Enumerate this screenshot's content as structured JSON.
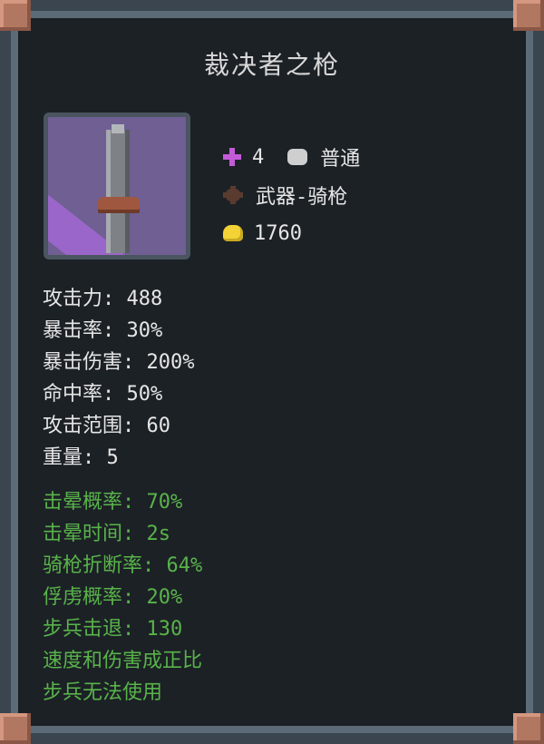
{
  "item": {
    "name": "裁决者之枪",
    "level": "4",
    "rarity": "普通",
    "type": "武器-骑枪",
    "price": "1760"
  },
  "stats": [
    {
      "label": "攻击力",
      "value": "488"
    },
    {
      "label": "暴击率",
      "value": "30%"
    },
    {
      "label": "暴击伤害",
      "value": "200%"
    },
    {
      "label": "命中率",
      "value": "50%"
    },
    {
      "label": "攻击范围",
      "value": "60"
    },
    {
      "label": "重量",
      "value": "5"
    }
  ],
  "bonuses": [
    {
      "text": "击晕概率: 70%"
    },
    {
      "text": "击晕时间: 2s"
    },
    {
      "text": "骑枪折断率: 64%"
    },
    {
      "text": "俘虏概率: 20%"
    },
    {
      "text": "步兵击退: 130"
    },
    {
      "text": "速度和伤害成正比"
    },
    {
      "text": "步兵无法使用"
    }
  ],
  "icons": {
    "level": "purple-star-icon",
    "rarity": "grey-rarity-icon",
    "type": "weapon-type-icon",
    "price": "gold-coin-icon",
    "item": "lance-item-icon"
  },
  "colors": {
    "stat_text": "#e6e6e6",
    "bonus_text": "#59b34a",
    "title_text": "#d8d8d8",
    "icon_bg": "#6f5f93",
    "panel_bg": "#1c2126"
  }
}
